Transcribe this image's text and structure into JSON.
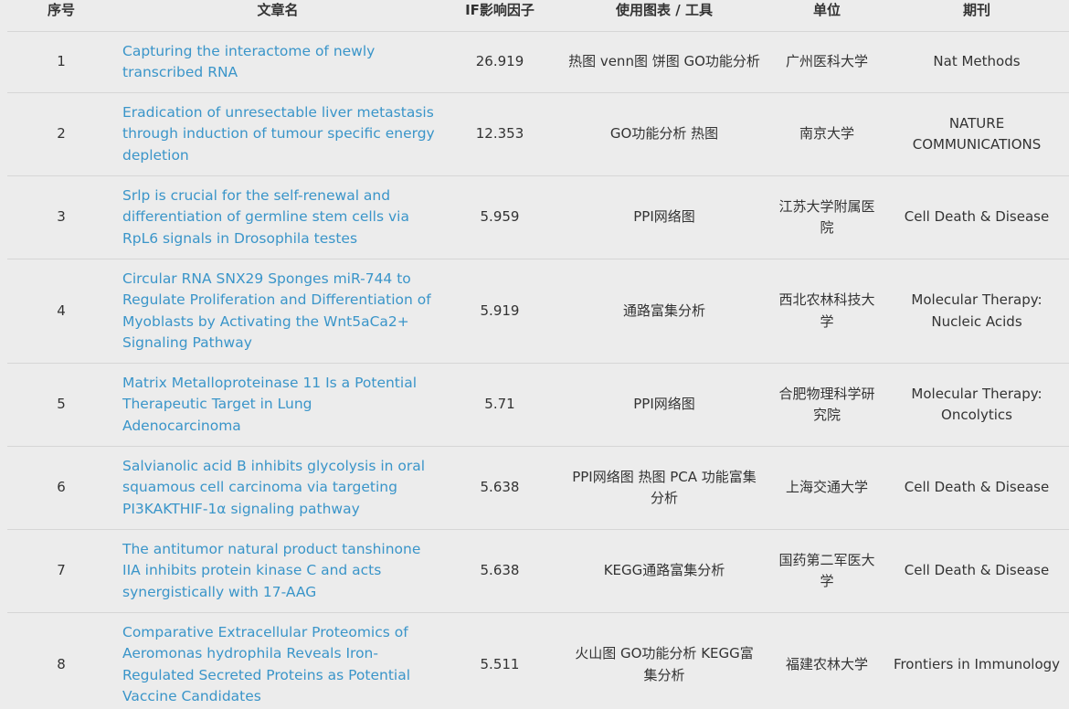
{
  "headers": {
    "index": "序号",
    "title": "文章名",
    "if": "IF影响因子",
    "tools": "使用图表 / 工具",
    "unit": "单位",
    "journal": "期刊"
  },
  "rows": [
    {
      "index": "1",
      "title": "Capturing the interactome of newly transcribed RNA",
      "if": "26.919",
      "tools": "热图 venn图 饼图 GO功能分析",
      "unit": "广州医科大学",
      "journal": "Nat Methods"
    },
    {
      "index": "2",
      "title": "Eradication of unresectable liver metastasis through induction of tumour specific energy depletion",
      "if": "12.353",
      "tools": "GO功能分析 热图",
      "unit": "南京大学",
      "journal": "NATURE COMMUNICATIONS"
    },
    {
      "index": "3",
      "title": "Srlp is crucial for the self-renewal and differentiation of germline stem cells via RpL6 signals in Drosophila testes",
      "if": "5.959",
      "tools": "PPI网络图",
      "unit": "江苏大学附属医院",
      "journal": "Cell Death & Disease"
    },
    {
      "index": "4",
      "title": "Circular RNA SNX29 Sponges miR-744 to Regulate Proliferation and Differentiation of Myoblasts by Activating the Wnt5aCa2+ Signaling Pathway",
      "if": "5.919",
      "tools": "通路富集分析",
      "unit": "西北农林科技大学",
      "journal": "Molecular Therapy: Nucleic Acids"
    },
    {
      "index": "5",
      "title": "Matrix Metalloproteinase 11 Is a Potential Therapeutic Target in Lung Adenocarcinoma",
      "if": "5.71",
      "tools": "PPI网络图",
      "unit": "合肥物理科学研究院",
      "journal": "Molecular Therapy: Oncolytics"
    },
    {
      "index": "6",
      "title": "Salvianolic acid B inhibits glycolysis in oral squamous cell carcinoma via targeting PI3KAKTHIF-1α signaling pathway",
      "if": "5.638",
      "tools": "PPI网络图 热图 PCA 功能富集分析",
      "unit": "上海交通大学",
      "journal": "Cell Death & Disease"
    },
    {
      "index": "7",
      "title": "The antitumor natural product tanshinone IIA inhibits protein kinase C and acts synergistically with 17-AAG",
      "if": "5.638",
      "tools": "KEGG通路富集分析",
      "unit": "国药第二军医大学",
      "journal": "Cell Death & Disease"
    },
    {
      "index": "8",
      "title": "Comparative Extracellular Proteomics of Aeromonas hydrophila Reveals Iron-Regulated Secreted Proteins as Potential Vaccine Candidates",
      "if": "5.511",
      "tools": "火山图 GO功能分析 KEGG富集分析",
      "unit": "福建农林大学",
      "journal": "Frontiers in Immunology"
    }
  ]
}
